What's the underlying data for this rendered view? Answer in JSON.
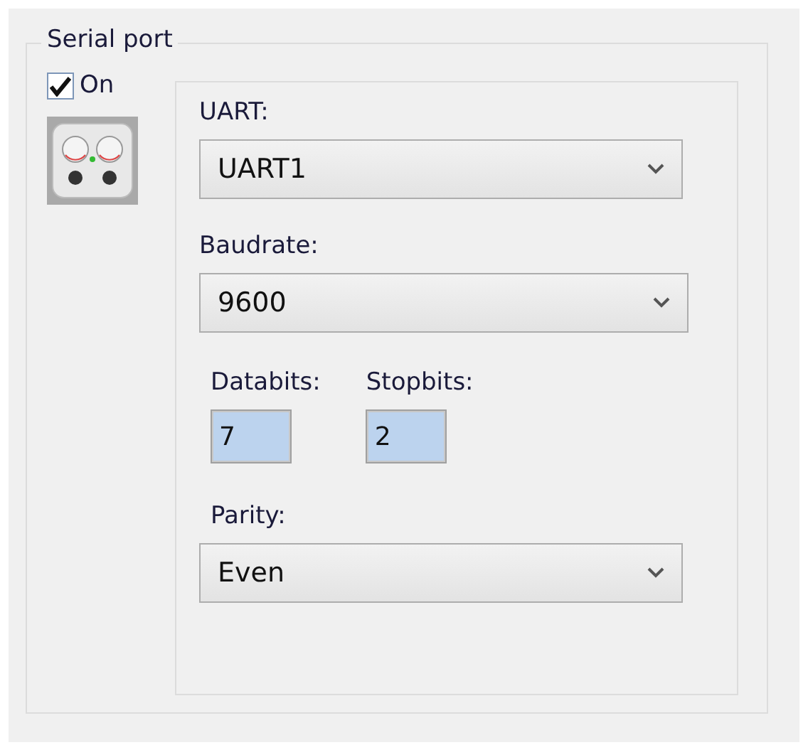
{
  "group": {
    "title": "Serial port"
  },
  "enable": {
    "label": "On",
    "checked": true
  },
  "uart": {
    "label": "UART:",
    "value": "UART1"
  },
  "baudrate": {
    "label": "Baudrate:",
    "value": "9600"
  },
  "databits": {
    "label": "Databits:",
    "value": "7"
  },
  "stopbits": {
    "label": "Stopbits:",
    "value": "2"
  },
  "parity": {
    "label": "Parity:",
    "value": "Even"
  }
}
